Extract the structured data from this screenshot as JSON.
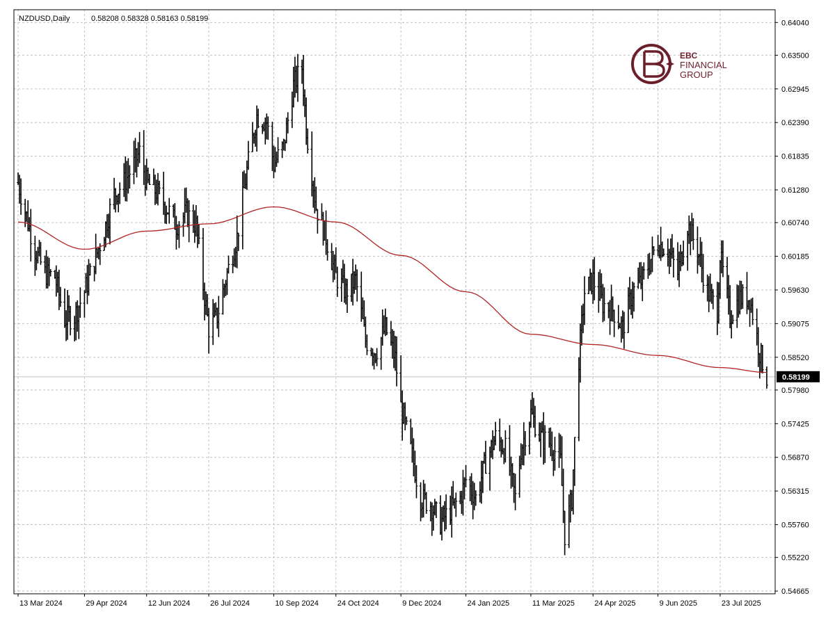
{
  "chart_info": {
    "symbol": "NZDUSD,Daily",
    "ohlc": "0.58208 0.58328 0.58163 0.58199"
  },
  "watermark": {
    "line1": "EBC",
    "line2": "FINANCIAL",
    "line3": "GROUP",
    "color": "#6b1f2a"
  },
  "colors": {
    "bars": "#000000",
    "moving_average": "#b22222",
    "grid": "#c0c0c0",
    "current_price_bg": "#000000",
    "current_price_line": "#c0c0c0"
  },
  "chart_data": {
    "type": "ohlc-bar",
    "title": "",
    "price_ticks": [
      "0.64040",
      "0.63500",
      "0.62945",
      "0.62390",
      "0.61835",
      "0.61280",
      "0.60740",
      "0.60185",
      "0.59630",
      "0.59075",
      "0.58520",
      "0.57980",
      "0.57425",
      "0.56870",
      "0.56315",
      "0.55760",
      "0.55220",
      "0.54665"
    ],
    "time_ticks": [
      "13 Mar 2024",
      "29 Apr 2024",
      "12 Jun 2024",
      "26 Jul 2024",
      "10 Sep 2024",
      "24 Oct 2024",
      "9 Dec 2024",
      "24 Jan 2025",
      "11 Mar 2025",
      "24 Apr 2025",
      "9 Jun 2025",
      "23 Jul 2025"
    ],
    "ylim": [
      0.5462,
      0.6425
    ],
    "current_price": "0.58199",
    "grid": true,
    "price_path": [
      [
        "13 Mar 2024",
        0.614
      ],
      [
        "20 Mar 2024",
        0.6075
      ],
      [
        "25 Mar 2024",
        0.603
      ],
      [
        "1 Apr 2024",
        0.599
      ],
      [
        "8 Apr 2024",
        0.5985
      ],
      [
        "15 Apr 2024",
        0.5915
      ],
      [
        "22 Apr 2024",
        0.592
      ],
      [
        "29 Apr 2024",
        0.596
      ],
      [
        "6 May 2024",
        0.601
      ],
      [
        "13 May 2024",
        0.606
      ],
      [
        "20 May 2024",
        0.612
      ],
      [
        "27 May 2024",
        0.614
      ],
      [
        "3 Jun 2024",
        0.617
      ],
      [
        "7 Jun 2024",
        0.619
      ],
      [
        "12 Jun 2024",
        0.614
      ],
      [
        "19 Jun 2024",
        0.6125
      ],
      [
        "26 Jun 2024",
        0.61
      ],
      [
        "3 Jul 2024",
        0.607
      ],
      [
        "10 Jul 2024",
        0.609
      ],
      [
        "17 Jul 2024",
        0.607
      ],
      [
        "22 Jul 2024",
        0.597
      ],
      [
        "26 Jul 2024",
        0.59
      ],
      [
        "1 Aug 2024",
        0.592
      ],
      [
        "8 Aug 2024",
        0.599
      ],
      [
        "15 Aug 2024",
        0.605
      ],
      [
        "22 Aug 2024",
        0.616
      ],
      [
        "29 Aug 2024",
        0.625
      ],
      [
        "5 Sep 2024",
        0.624
      ],
      [
        "10 Sep 2024",
        0.617
      ],
      [
        "17 Sep 2024",
        0.62
      ],
      [
        "24 Sep 2024",
        0.63
      ],
      [
        "30 Sep 2024",
        0.633
      ],
      [
        "3 Oct 2024",
        0.623
      ],
      [
        "10 Oct 2024",
        0.61
      ],
      [
        "17 Oct 2024",
        0.605
      ],
      [
        "24 Oct 2024",
        0.5985
      ],
      [
        "31 Oct 2024",
        0.596
      ],
      [
        "7 Nov 2024",
        0.598
      ],
      [
        "14 Nov 2024",
        0.588
      ],
      [
        "21 Nov 2024",
        0.586
      ],
      [
        "28 Nov 2024",
        0.59
      ],
      [
        "5 Dec 2024",
        0.585
      ],
      [
        "9 Dec 2024",
        0.577
      ],
      [
        "16 Dec 2024",
        0.57
      ],
      [
        "23 Dec 2024",
        0.562
      ],
      [
        "30 Dec 2024",
        0.561
      ],
      [
        "6 Jan 2025",
        0.558
      ],
      [
        "13 Jan 2025",
        0.56
      ],
      [
        "20 Jan 2025",
        0.562
      ],
      [
        "24 Jan 2025",
        0.565
      ],
      [
        "31 Jan 2025",
        0.562
      ],
      [
        "7 Feb 2025",
        0.568
      ],
      [
        "14 Feb 2025",
        0.572
      ],
      [
        "21 Feb 2025",
        0.57
      ],
      [
        "28 Feb 2025",
        0.562
      ],
      [
        "4 Mar 2025",
        0.57
      ],
      [
        "11 Mar 2025",
        0.576
      ],
      [
        "18 Mar 2025",
        0.572
      ],
      [
        "25 Mar 2025",
        0.571
      ],
      [
        "1 Apr 2025",
        0.568
      ],
      [
        "4 Apr 2025",
        0.556
      ],
      [
        "9 Apr 2025",
        0.562
      ],
      [
        "14 Apr 2025",
        0.585
      ],
      [
        "18 Apr 2025",
        0.596
      ],
      [
        "24 Apr 2025",
        0.598
      ],
      [
        "1 May 2025",
        0.594
      ],
      [
        "8 May 2025",
        0.593
      ],
      [
        "15 May 2025",
        0.59
      ],
      [
        "22 May 2025",
        0.596
      ],
      [
        "29 May 2025",
        0.598
      ],
      [
        "5 Jun 2025",
        0.602
      ],
      [
        "9 Jun 2025",
        0.604
      ],
      [
        "16 Jun 2025",
        0.603
      ],
      [
        "23 Jun 2025",
        0.599
      ],
      [
        "30 Jun 2025",
        0.607
      ],
      [
        "7 Jul 2025",
        0.603
      ],
      [
        "14 Jul 2025",
        0.596
      ],
      [
        "21 Jul 2025",
        0.593
      ],
      [
        "23 Jul 2025",
        0.602
      ],
      [
        "30 Jul 2025",
        0.592
      ],
      [
        "6 Aug 2025",
        0.595
      ],
      [
        "13 Aug 2025",
        0.595
      ],
      [
        "20 Aug 2025",
        0.586
      ],
      [
        "25 Aug 2025",
        0.582
      ]
    ],
    "moving_average": [
      [
        "13 Mar 2024",
        0.6075
      ],
      [
        "29 Apr 2024",
        0.603
      ],
      [
        "12 Jun 2024",
        0.606
      ],
      [
        "26 Jul 2024",
        0.6072
      ],
      [
        "10 Sep 2024",
        0.61
      ],
      [
        "24 Oct 2024",
        0.6075
      ],
      [
        "9 Dec 2024",
        0.602
      ],
      [
        "24 Jan 2025",
        0.596
      ],
      [
        "11 Mar 2025",
        0.589
      ],
      [
        "24 Apr 2025",
        0.5873
      ],
      [
        "9 Jun 2025",
        0.5855
      ],
      [
        "23 Jul 2025",
        0.5835
      ],
      [
        "25 Aug 2025",
        0.5827
      ]
    ]
  }
}
